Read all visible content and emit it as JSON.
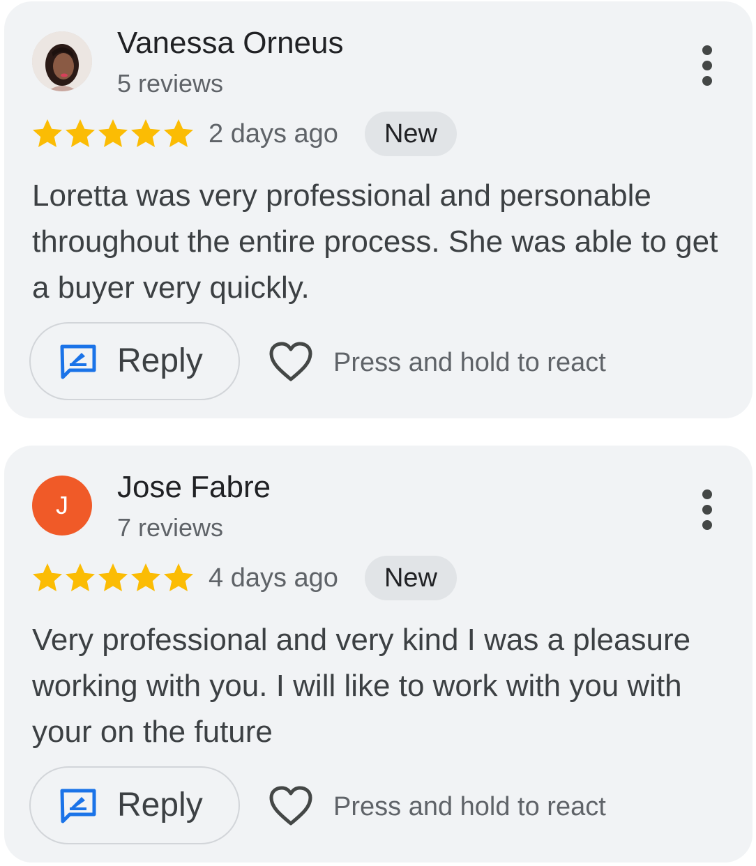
{
  "reviews": [
    {
      "author": "Vanessa Orneus",
      "review_count": "5 reviews",
      "avatar_type": "photo",
      "rating": 5,
      "max_rating": 5,
      "date": "2 days ago",
      "badge": "New",
      "text": "Loretta was very professional and personable throughout the entire process. She was able to get a buyer very quickly.",
      "reply_label": "Reply",
      "react_label": "Press and hold to react"
    },
    {
      "author": "Jose Fabre",
      "review_count": "7 reviews",
      "avatar_type": "letter",
      "avatar_letter": "J",
      "avatar_color": "#f05a28",
      "rating": 5,
      "max_rating": 5,
      "date": "4 days ago",
      "badge": "New",
      "text": "Very professional and very kind I was a pleasure working with you. I will like to work with you with your on the future",
      "reply_label": "Reply",
      "react_label": "Press and hold to react"
    }
  ],
  "colors": {
    "star": "#fbbc04",
    "reply_icon": "#1a73e8",
    "card_background": "#f1f3f5",
    "badge_background": "#e1e4e7"
  },
  "icons": {
    "reply": "reply-icon",
    "react": "heart-icon",
    "more": "more-vert-icon",
    "star": "star-icon"
  }
}
